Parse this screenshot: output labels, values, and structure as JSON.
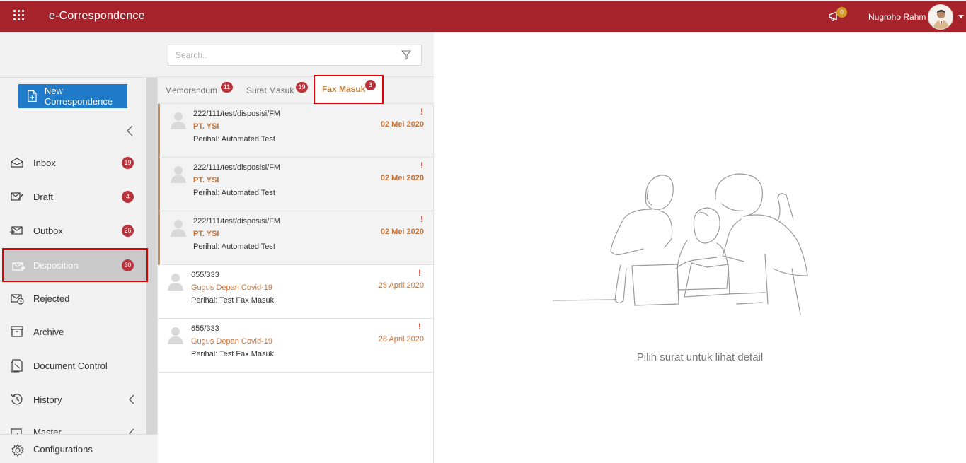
{
  "header": {
    "app_title": "e-Correspondence",
    "notification_count": "0",
    "user_name": "Nugroho Rahm"
  },
  "sidebar": {
    "new_button_label": "New Correspondence",
    "items": [
      {
        "label": "Inbox",
        "badge": "19",
        "icon": "inbox-icon"
      },
      {
        "label": "Draft",
        "badge": "4",
        "icon": "draft-icon"
      },
      {
        "label": "Outbox",
        "badge": "26",
        "icon": "outbox-icon"
      },
      {
        "label": "Disposition",
        "badge": "30",
        "icon": "disposition-icon",
        "active": true
      },
      {
        "label": "Rejected",
        "icon": "rejected-icon"
      },
      {
        "label": "Archive",
        "icon": "archive-icon"
      },
      {
        "label": "Document Control",
        "icon": "document-control-icon"
      },
      {
        "label": "History",
        "icon": "history-icon"
      },
      {
        "label": "Master",
        "icon": "master-icon"
      }
    ],
    "config_label": "Configurations"
  },
  "search": {
    "placeholder": "Search.."
  },
  "tabs": [
    {
      "label": "Memorandum",
      "badge": "11"
    },
    {
      "label": "Surat Masuk",
      "badge": "19"
    },
    {
      "label": "Fax Masuk",
      "badge": "3",
      "active": true
    }
  ],
  "messages": [
    {
      "number": "222/111/test/disposisi/FM",
      "from": "PT. YSI",
      "subject": "Perihal: Automated Test",
      "date": "02 Mei 2020",
      "flag": "!",
      "unread": true
    },
    {
      "number": "222/111/test/disposisi/FM",
      "from": "PT. YSI",
      "subject": "Perihal: Automated Test",
      "date": "02 Mei 2020",
      "flag": "!",
      "unread": true
    },
    {
      "number": "222/111/test/disposisi/FM",
      "from": "PT. YSI",
      "subject": "Perihal: Automated Test",
      "date": "02 Mei 2020",
      "flag": "!",
      "unread": true
    },
    {
      "number": "655/333",
      "from": "Gugus Depan Covid-19",
      "subject": "Perihal: Test Fax Masuk",
      "date": "28 April 2020",
      "flag": "!",
      "unread": false
    },
    {
      "number": "655/333",
      "from": "Gugus Depan Covid-19",
      "subject": "Perihal: Test Fax Masuk",
      "date": "28 April 2020",
      "flag": "!",
      "unread": false
    }
  ],
  "detail": {
    "empty_text": "Pilih surat untuk lihat detail"
  },
  "colors": {
    "brand": "#a6232c",
    "primary_button": "#1f7ac9",
    "badge": "#b8343c",
    "accent": "#c6733a"
  }
}
